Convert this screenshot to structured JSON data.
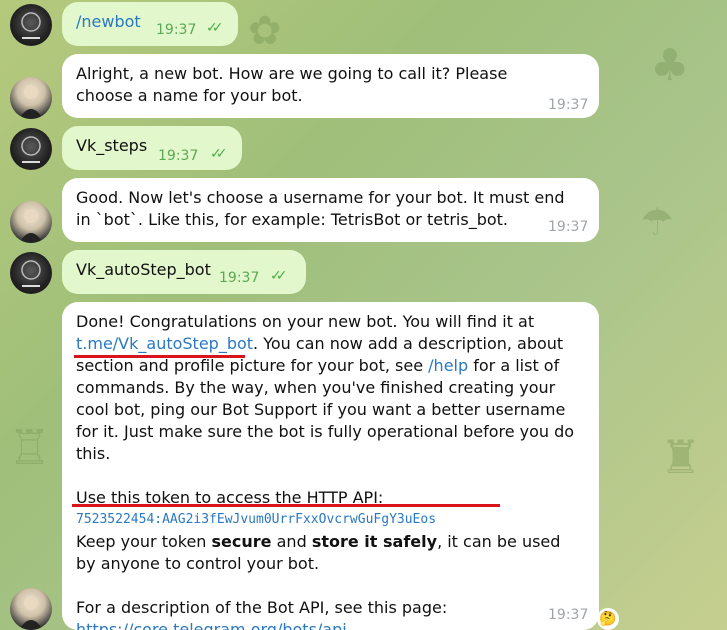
{
  "messages": [
    {
      "text": "/newbot",
      "time": "19:37"
    },
    {
      "text": "Alright, a new bot. How are we going to call it? Please choose a name for your bot.",
      "time": "19:37"
    },
    {
      "text": "Vk_steps",
      "time": "19:37"
    },
    {
      "text": "Good. Now let's choose a username for your bot. It must end in `bot`. Like this, for example: TetrisBot or tetris_bot.",
      "time": "19:37"
    },
    {
      "text": "Vk_autoStep_bot",
      "time": "19:37"
    }
  ],
  "final": {
    "p1_a": "Done! Congratulations on your new bot. You will find it at",
    "bot_link": "t.me/Vk_autoStep_bot",
    "p1_b": ". You can now add a description, about section and profile picture for your bot, see",
    "help_link": "/help",
    "p1_c": "for a list of commands. By the way, when you've finished creating your cool bot, ping our Bot Support if you want a better username for it. Just make sure the bot is fully operational before you do this.",
    "p2": "Use this token to access the HTTP API:",
    "token": "7523522454:AAG2i3fEwJvum0UrrFxxOvcrwGuFgY3uEos",
    "p3_a": "Keep your token",
    "p3_secure": "secure",
    "p3_and": "and",
    "p3_store": "store it safely",
    "p3_b": ", it can be used by anyone to control your bot.",
    "p4": "For a description of the Bot API, see this page:",
    "api_link": "https://core.telegram.org/bots/api",
    "time": "19:37"
  },
  "reaction_emoji": "🤔",
  "colors": {
    "outgoing_bubble": "#e2f7cb",
    "incoming_bubble": "#ffffff",
    "link": "#2a78c2",
    "annotation_red": "#d9141a"
  }
}
